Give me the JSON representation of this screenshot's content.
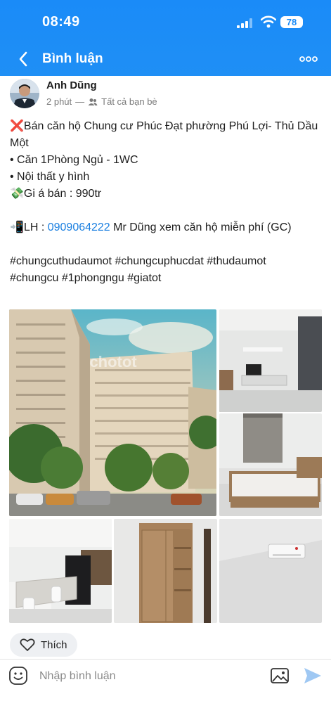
{
  "status_bar": {
    "time": "08:49",
    "battery": "78"
  },
  "navbar": {
    "title": "Bình luận"
  },
  "post": {
    "author": "Anh Dũng",
    "time_ago": "2 phút",
    "separator": "—",
    "audience": "Tất cả bạn bè",
    "lines": {
      "l1_emoji": "❌",
      "l1": "Bán căn hộ Chung cư Phúc Đạt phường Phú Lợi- Thủ Dầu Một",
      "l2": "• Căn 1Phòng Ngủ - 1WC",
      "l3": "• Nội thất y hình",
      "l4_emoji": "💸",
      "l4": "Gi á bán : 990tr",
      "l5_emoji": "📲",
      "l5_prefix": "LH : ",
      "phone": "0909064222",
      "l5_suffix": " Mr Dũng xem căn hộ miễn phí (GC)",
      "hashtags_1": "#chungcuthudaumot #chungcuphucdat #thudaumot",
      "hashtags_2": "#chungcu #1phongngu #giatot"
    },
    "watermark": "chotot"
  },
  "actions": {
    "like_label": "Thích"
  },
  "composer": {
    "placeholder": "Nhập bình luận"
  },
  "colors": {
    "accent": "#1a8bf8",
    "link": "#1a7fe0"
  }
}
